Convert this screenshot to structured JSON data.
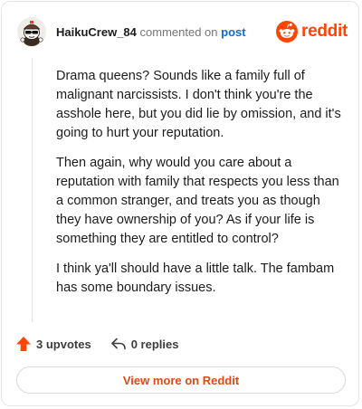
{
  "comment": {
    "username": "HaikuCrew_84",
    "commented_on": "commented on",
    "post_link": "post",
    "paragraphs": [
      "Drama queens? Sounds like a family full of malignant narcissists. I don't think you're the asshole here, but you did lie by omission, and it's going to hurt your reputation.",
      "Then again, why would you care about a reputation with family that respects you less than a common stranger, and treats you as though they have ownership of you? As if your life is something they are entitled to control?",
      "I think ya'll should have a little talk. The fambam has some boundary issues."
    ]
  },
  "brand": {
    "name": "reddit",
    "color": "#ff4500"
  },
  "actions": {
    "upvotes_label": "3 upvotes",
    "replies_label": "0 replies"
  },
  "view_more_label": "View more on Reddit",
  "icons": {
    "avatar": "user-avatar",
    "upvote": "upvote-arrow-icon",
    "reply": "reply-arrow-icon",
    "brand": "reddit-alien-logo"
  },
  "colors": {
    "accent": "#ff4500",
    "link": "#0f6bd6",
    "button_text": "#e0490f"
  }
}
